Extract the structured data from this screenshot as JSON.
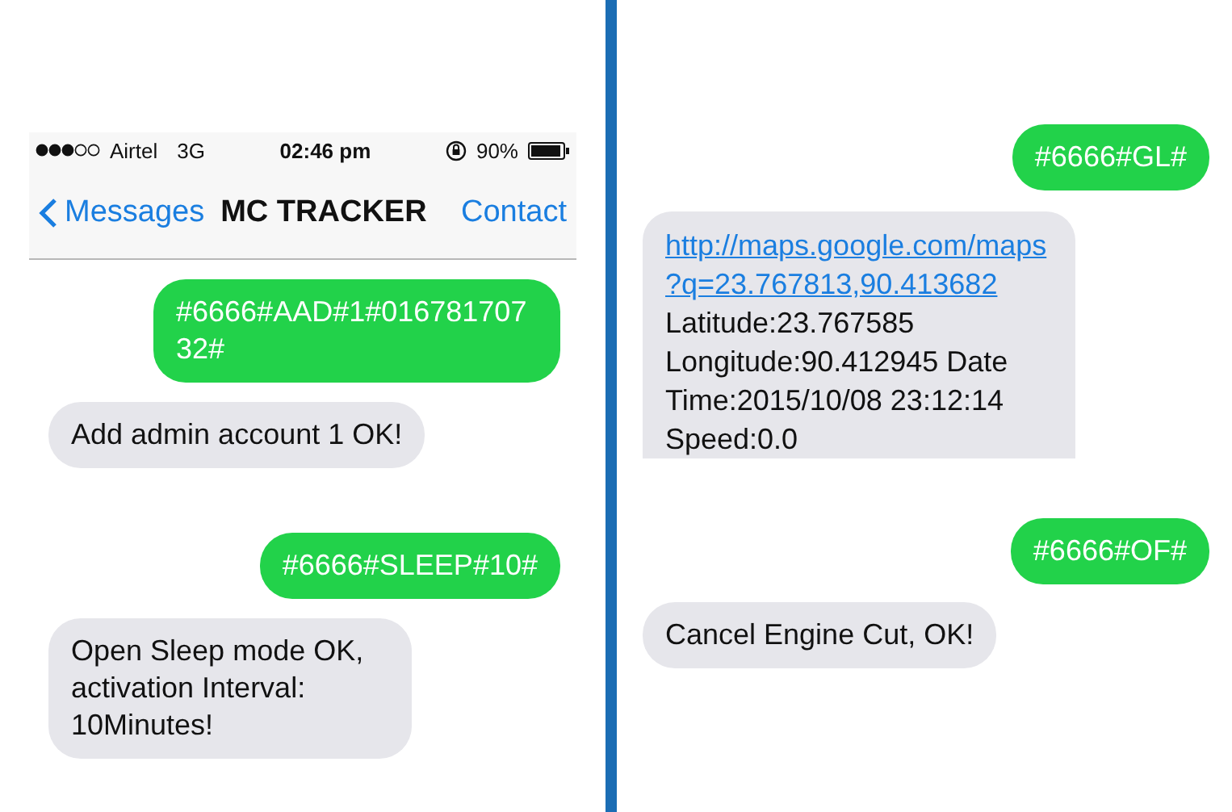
{
  "left_phone": {
    "status_bar": {
      "carrier": "Airtel",
      "network": "3G",
      "time": "02:46 pm",
      "battery": "90%"
    },
    "nav_bar": {
      "back": "Messages",
      "title": "MC TRACKER",
      "action": "Contact"
    },
    "messages": [
      {
        "kind": "sent",
        "text": "#6666#AAD#1#01678170732#"
      },
      {
        "kind": "received",
        "text": "Add admin account 1 OK!"
      },
      {
        "kind": "sent",
        "text": "#6666#SLEEP#10#"
      },
      {
        "kind": "received",
        "text": "Open Sleep mode OK, activation Interval: 10Minutes!"
      }
    ]
  },
  "right_phone": {
    "messages": [
      {
        "kind": "sent",
        "text": "#6666#GL#"
      },
      {
        "kind": "received",
        "link": "http://maps.google.com/maps?q=23.767813,90.413682",
        "text": "Latitude:23.767585 Longitude:90.412945 Date Time:2015/10/08 23:12:14 Speed:0.0",
        "cut": true
      },
      {
        "kind": "sent",
        "text": "#6666#OF#"
      },
      {
        "kind": "received",
        "text": "Cancel Engine Cut, OK!"
      }
    ]
  }
}
